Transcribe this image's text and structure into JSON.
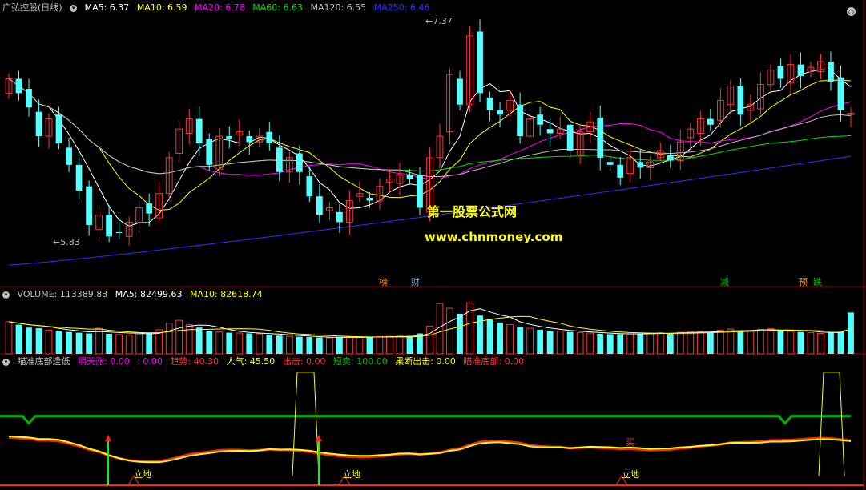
{
  "main_header": {
    "title": "广弘控股(日线)",
    "ma5": "MA5: 6.37",
    "ma10": "MA10: 6.59",
    "ma20": "MA20: 6.78",
    "ma60": "MA60: 6.63",
    "ma120": "MA120: 6.55",
    "ma250": "MA250: 6.46"
  },
  "vol_header": {
    "volume": "VOLUME: 113389.83",
    "ma5": "MA5: 82499.63",
    "ma10": "MA10: 82618.74"
  },
  "ind_header": {
    "title": "瞄准底部逢低",
    "mingtian": "明天涨: 0.00",
    "blank": ": 0.00",
    "qushi": "趋势: 40.30",
    "renqi": "人气: 45.50",
    "chuji": "出击: 0.00",
    "duanmai": "短卖: 100.00",
    "guoduan": "果断出击: 0.00",
    "miaozhun": "瞄准底部: 0.00"
  },
  "watermark": {
    "line1": "第一股票公式网",
    "line2": "www.chnmoney.com"
  },
  "event_tags": [
    "榜",
    "财",
    "减",
    "预",
    "跌"
  ],
  "price_annotations": {
    "high": "7.37",
    "low": "5.83"
  },
  "signal_labels": {
    "lidi": "立地",
    "mai": "买"
  },
  "colors": {
    "up": "#ff3232",
    "down": "#54ffff",
    "ma5": "#ffffff",
    "ma10": "#ffff00",
    "ma20": "#ff00ff",
    "ma60": "#00e000",
    "ma120": "#c0c0c0",
    "ma250": "#3030ff",
    "grid": "#a00000"
  },
  "chart_data": {
    "type": "candlestick",
    "title": "广弘控股(日线)",
    "bars": 85,
    "price_range": [
      5.65,
      7.45
    ],
    "marked_high": 7.37,
    "marked_low": 5.83,
    "close": [
      7.0,
      6.9,
      6.8,
      6.6,
      6.72,
      6.55,
      6.4,
      6.22,
      5.98,
      6.05,
      5.9,
      5.93,
      6.0,
      6.1,
      6.06,
      6.2,
      6.45,
      6.65,
      6.72,
      6.55,
      6.4,
      6.6,
      6.58,
      6.63,
      6.56,
      6.6,
      6.55,
      6.35,
      6.45,
      6.35,
      6.18,
      6.05,
      6.1,
      6.0,
      6.15,
      6.2,
      6.15,
      6.25,
      6.3,
      6.33,
      6.3,
      6.1,
      6.45,
      6.6,
      7.03,
      6.82,
      7.3,
      6.9,
      6.78,
      6.75,
      6.85,
      6.6,
      6.72,
      6.68,
      6.62,
      6.65,
      6.5,
      6.63,
      6.7,
      6.45,
      6.4,
      6.31,
      6.45,
      6.38,
      6.42,
      6.5,
      6.43,
      6.56,
      6.65,
      6.72,
      6.68,
      6.85,
      6.95,
      6.75,
      6.82,
      6.96,
      7.06,
      7.0,
      7.1,
      7.02,
      7.08,
      7.12,
      6.98,
      6.78,
      6.76
    ],
    "volume": [
      88000,
      80000,
      72000,
      70000,
      65000,
      62000,
      60000,
      58000,
      56000,
      70000,
      55000,
      53000,
      52000,
      54000,
      58000,
      66000,
      84000,
      92000,
      80000,
      72000,
      62000,
      60000,
      58000,
      57000,
      56000,
      55000,
      52000,
      50000,
      48000,
      47000,
      46000,
      45000,
      44000,
      45000,
      46000,
      46500,
      47000,
      47500,
      48000,
      48500,
      49000,
      56000,
      76000,
      138000,
      125000,
      110000,
      140000,
      105000,
      94000,
      86000,
      80000,
      74000,
      70000,
      66000,
      64000,
      62000,
      60000,
      58000,
      57000,
      55000,
      54000,
      54000,
      55000,
      56000,
      57000,
      58000,
      57000,
      59000,
      61000,
      62000,
      60000,
      65000,
      68000,
      63000,
      64000,
      67000,
      69000,
      64000,
      62000,
      60000,
      58000,
      56000,
      58000,
      60000,
      113389.83
    ],
    "volume_ma5": 82499.63,
    "volume_ma10": 82618.74,
    "indicator": {
      "lines": [
        "趋势",
        "人气",
        "短卖"
      ],
      "values": {
        "明天涨": 0.0,
        "趋势": 40.3,
        "人气": 45.5,
        "出击": 0.0,
        "短卖": 100.0,
        "果断出击": 0.0,
        "瞄准底部": 0.0
      }
    },
    "legend": [
      "MA5",
      "MA10",
      "MA20",
      "MA60",
      "MA120",
      "MA250"
    ]
  }
}
